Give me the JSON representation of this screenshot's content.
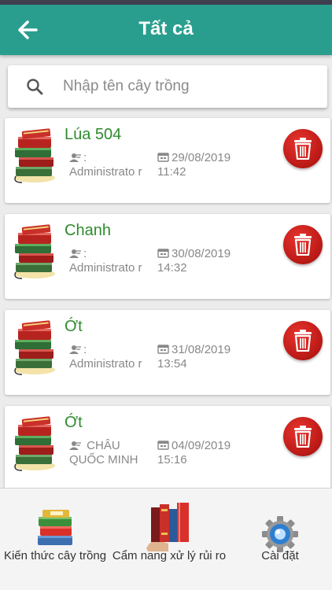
{
  "header": {
    "title": "Tất cả",
    "back_icon": "arrow-left-icon",
    "color": "#2a9e8e"
  },
  "search": {
    "placeholder": "Nhập tên cây trồng",
    "value": ""
  },
  "crops": [
    {
      "name": "Lúa 504",
      "user_label": ": Administrato r",
      "date": "29/08/2019",
      "time": "11:42"
    },
    {
      "name": "Chanh",
      "user_label": ": Administrato r",
      "date": "30/08/2019",
      "time": "14:32"
    },
    {
      "name": "Ớt",
      "user_label": ": Administrato r",
      "date": "31/08/2019",
      "time": "13:54"
    },
    {
      "name": "Ớt",
      "user_label": " CHÂU QUỐC MINH",
      "date": "04/09/2019",
      "time": "15:16"
    }
  ],
  "bottom_nav": {
    "knowledge": "Kiến thức cây trồng",
    "handbook": "Cẩm nang xử lý rủi ro",
    "settings": "Cài đặt"
  },
  "colors": {
    "crop_name": "#2e8b2e",
    "delete": "#c41e1a"
  }
}
